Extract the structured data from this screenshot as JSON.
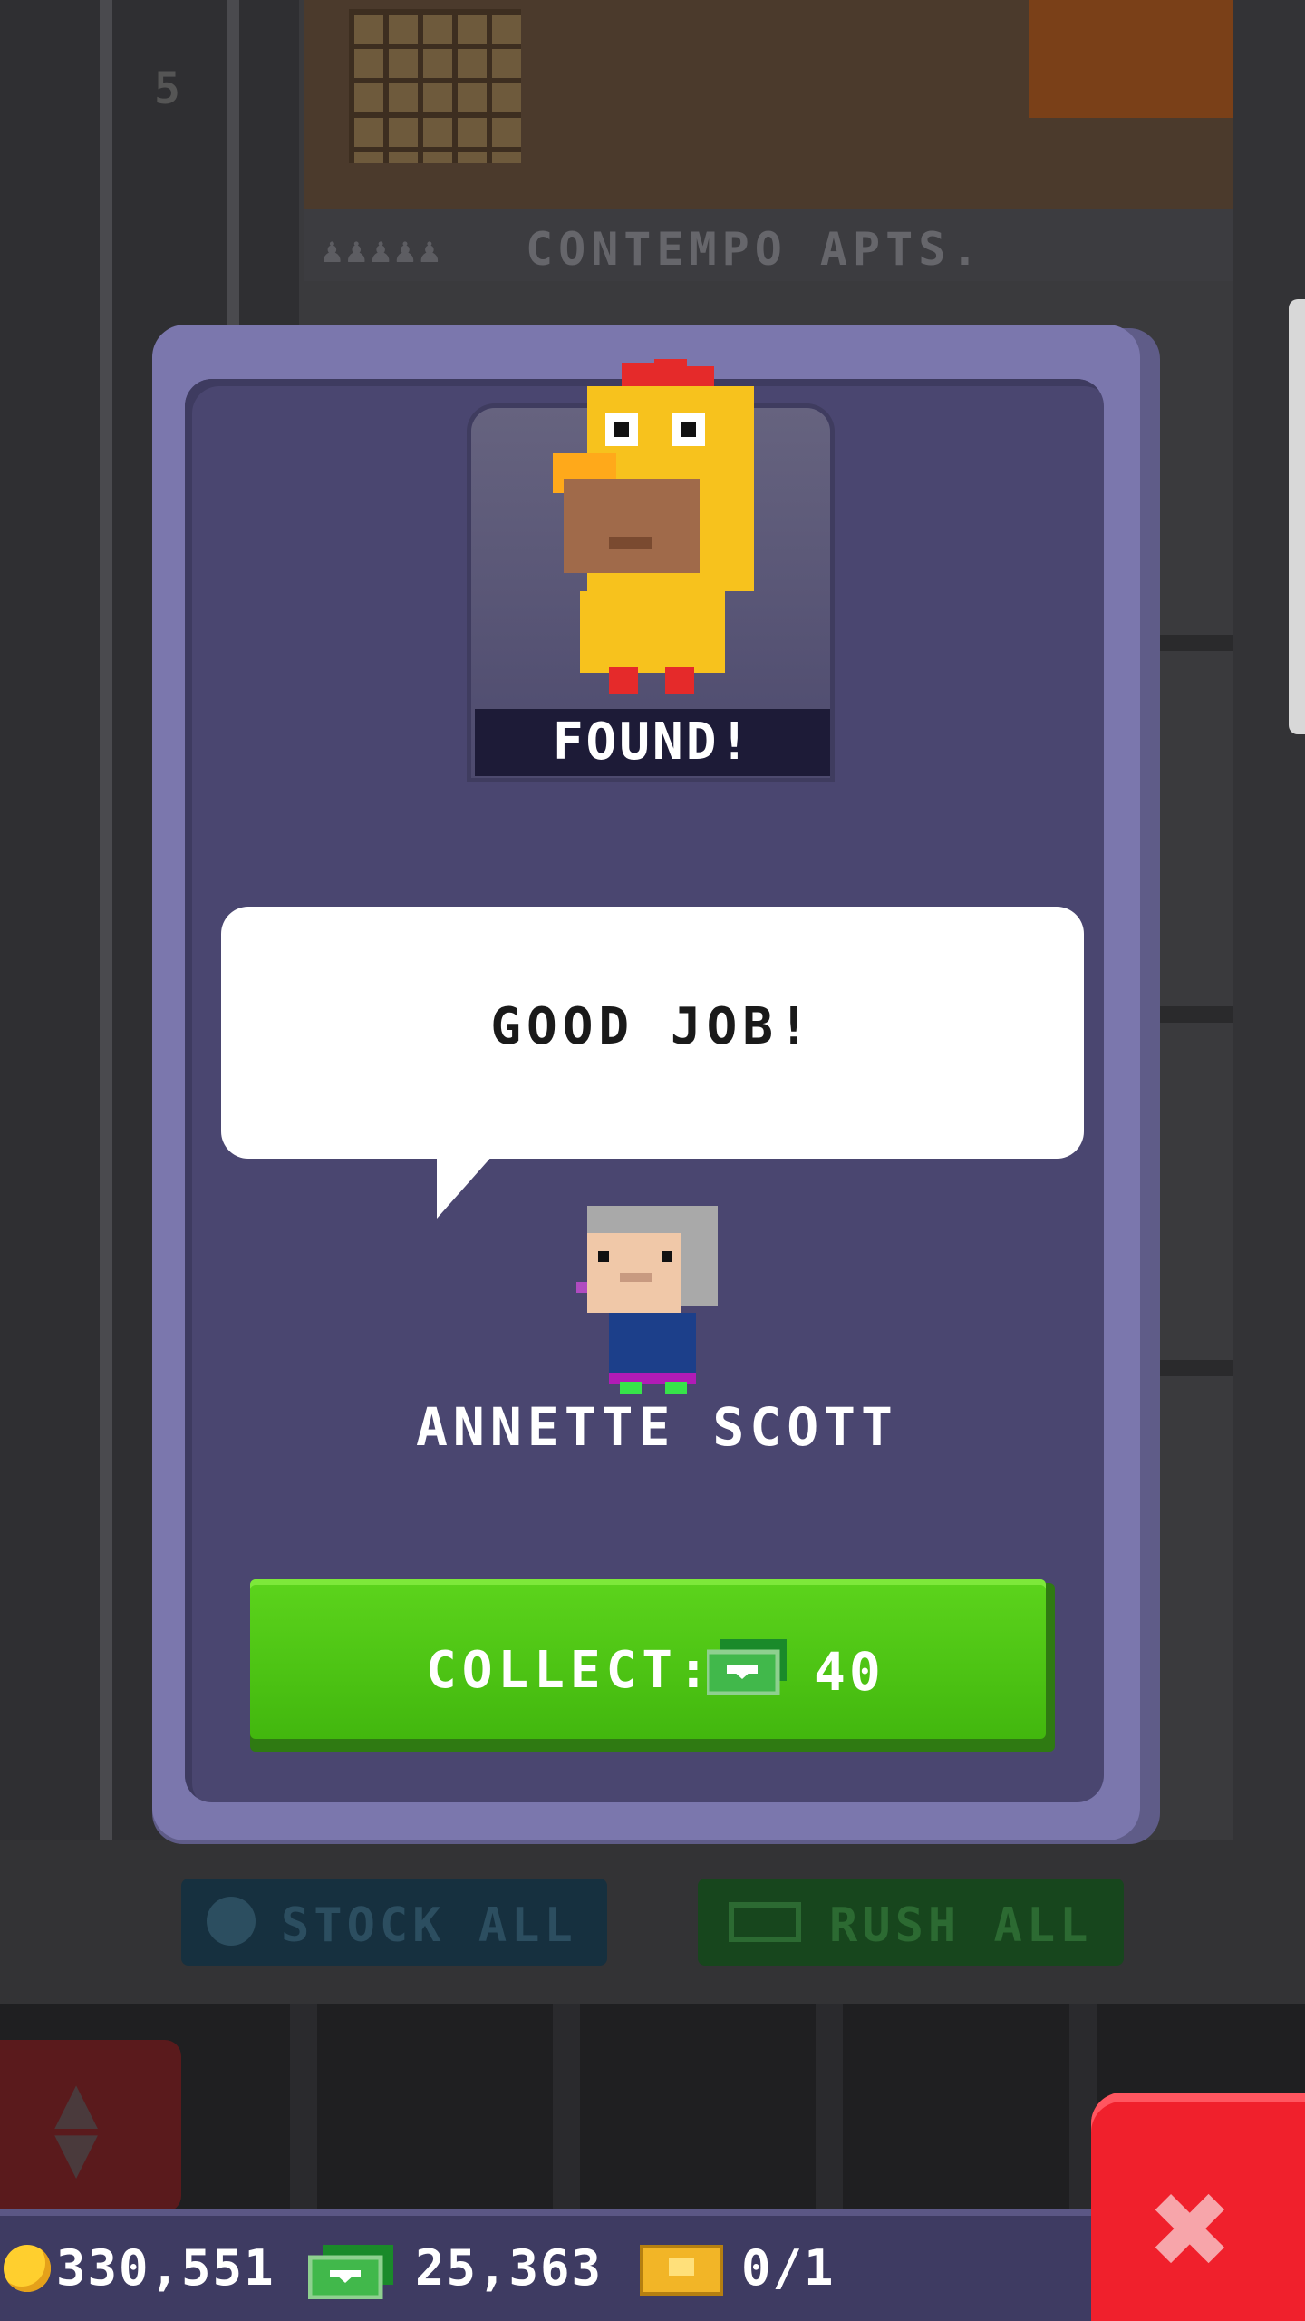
{
  "scene": {
    "floor_number": "5",
    "floor_name": "CONTEMPO APTS."
  },
  "action_bar": {
    "stock_all": "STOCK ALL",
    "rush_all": "RUSH ALL"
  },
  "modal": {
    "status": "FOUND!",
    "speech": "GOOD JOB!",
    "npc_name": "ANNETTE SCOTT",
    "collect_label": "COLLECT:",
    "collect_amount": "40"
  },
  "hud": {
    "coins": "330,551",
    "bux": "25,363",
    "tickets": "0/1"
  },
  "icons": {
    "coin": "coin-icon",
    "bux": "tower-bux-icon",
    "ticket": "golden-ticket-icon",
    "close": "close-icon",
    "elevator": "elevator-updown-icon"
  },
  "colors": {
    "card": "#7b77ad",
    "card_inner": "#4a4670",
    "collect_green": "#4cc414",
    "close_red": "#f0202c"
  }
}
